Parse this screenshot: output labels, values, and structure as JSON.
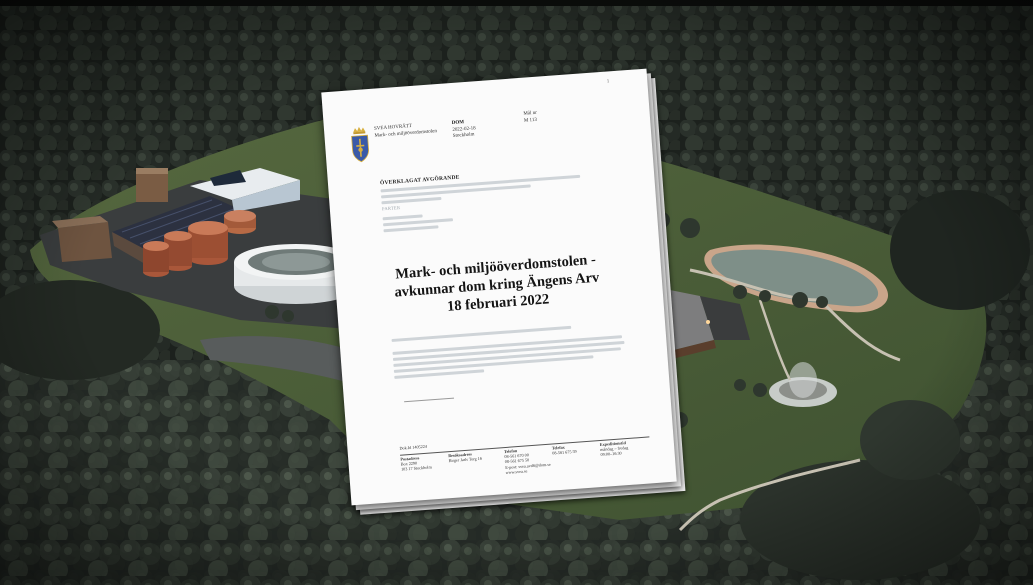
{
  "document": {
    "page_number": "1",
    "court_name": "SVEA HOVRÄTT",
    "court_division": "Mark- och miljööverdomstolen",
    "dom_title": "DOM",
    "dom_date": "2022-02-18",
    "dom_place": "Stockholm",
    "mal_label": "Mål nr",
    "mal_number": "M 113",
    "overklagat_heading": "ÖVERKLAGAT AVGÖRANDE",
    "parter_heading": "PARTER",
    "headline_lines": [
      "Mark- och miljööverdomstolen -",
      "avkunnar dom kring Ängens Arv",
      "18 februari 2022"
    ],
    "footer": {
      "doc_id": "Dok.Id 1405224",
      "postadress_label": "Postadress",
      "postadress_value": "Box 2290\n103 17 Stockholm",
      "besoksadress_label": "Besöksadress",
      "besoksadress_value": "Birger Jarls Torg 16",
      "telefon_label": "Telefon",
      "telefon_value": "08-561 670 00\n08-561 675 50\nE-post: svea.avd6@dom.se\nwww.svea.se",
      "telefax_label": "Telefax",
      "telefax_value": "08-561 675 59",
      "expeditionstid_label": "Expeditionstid",
      "expeditionstid_value": "måndag – fredag\n09:00–16:30"
    }
  },
  "colors": {
    "forest_dark": "#1e231f",
    "lawn_green": "#4b5f3a",
    "water": "#7e8f88",
    "paper": "#fbfbfb",
    "crest_blue": "#3a5aa8",
    "crest_gold": "#d8b040"
  }
}
